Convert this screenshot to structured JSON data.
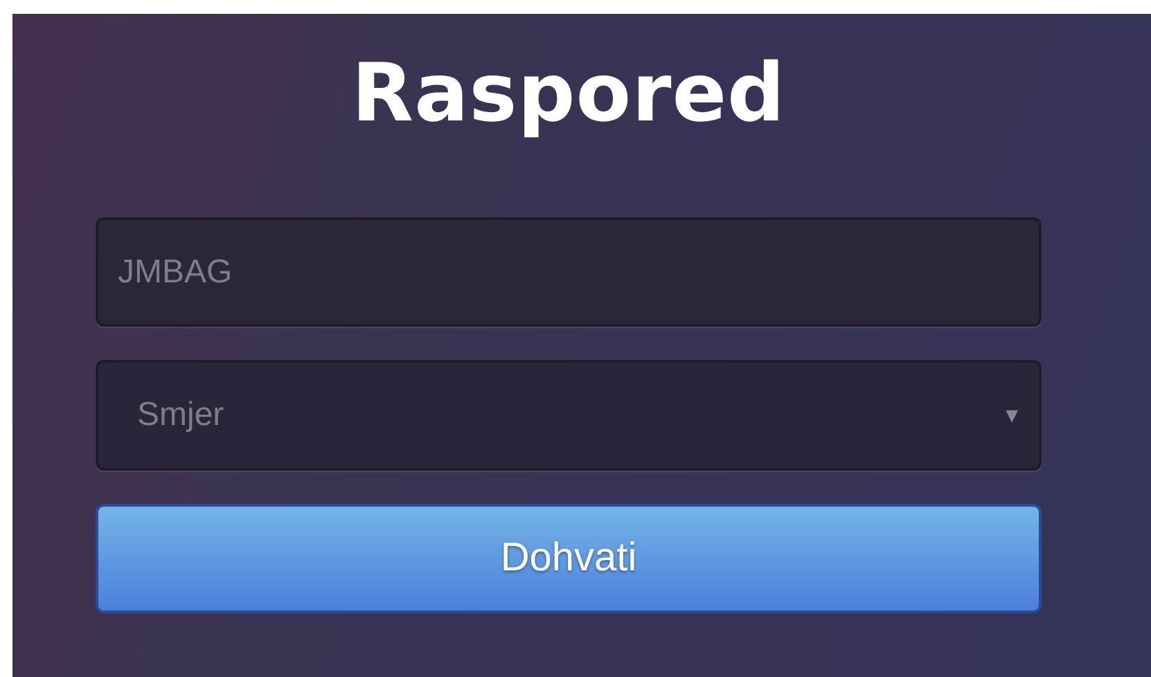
{
  "title": "Raspored",
  "jmbag_field": {
    "placeholder": "JMBAG"
  },
  "smjer_select": {
    "placeholder": "Smjer",
    "arrow": "▼"
  },
  "submit_button": {
    "label": "Dohvati"
  }
}
